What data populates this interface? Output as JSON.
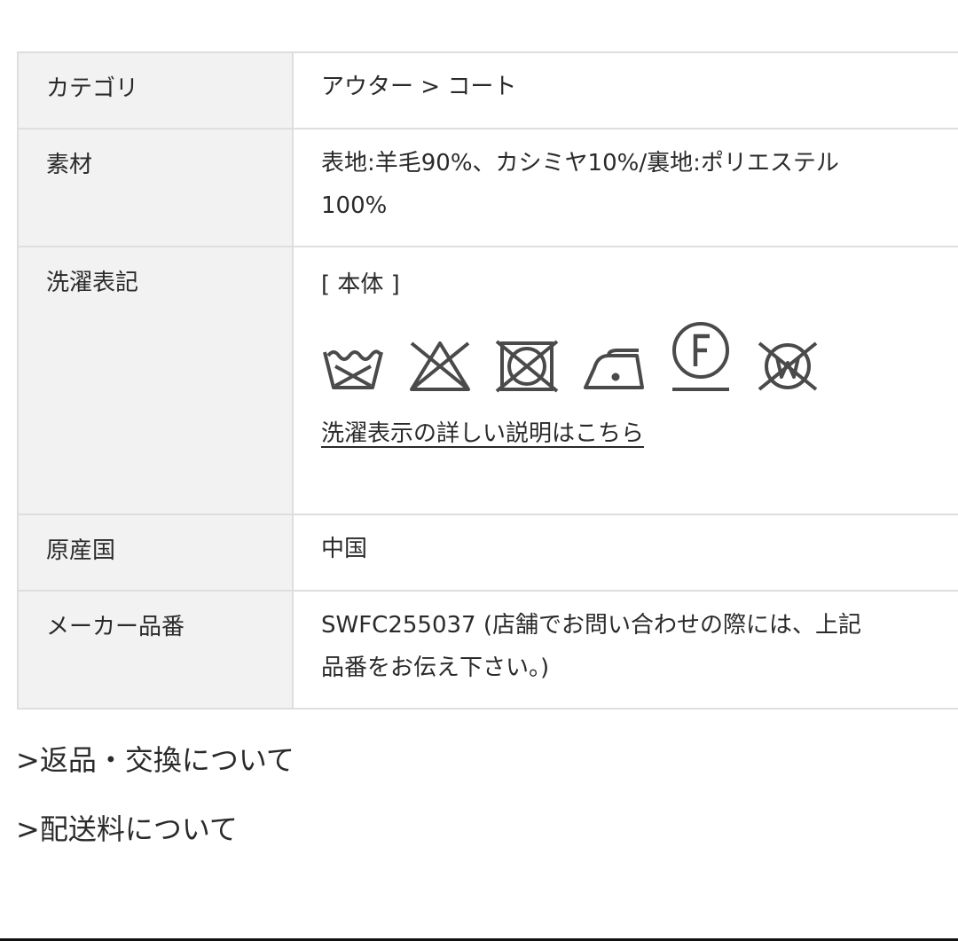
{
  "specs": {
    "category": {
      "label": "カテゴリ",
      "value": "アウター > コート"
    },
    "material": {
      "label": "素材",
      "value_line1": "表地:羊毛90%、カシミヤ10%/裏地:ポリエステル",
      "value_line2": "100%"
    },
    "care": {
      "label": "洗濯表記",
      "section": "[ 本体 ]",
      "icons": [
        "wash-tub-icon",
        "no-bleach-icon",
        "no-tumble-dry-icon",
        "low-iron-icon",
        "dry-clean-f-icon",
        "no-wet-clean-icon"
      ],
      "link": "洗濯表示の詳しい説明はこちら"
    },
    "origin": {
      "label": "原産国",
      "value": "中国"
    },
    "maker": {
      "label": "メーカー品番",
      "value_line1": "SWFC255037 (店舗でお問い合わせの際には、上記",
      "value_line2": "品番をお伝え下さい。)"
    }
  },
  "links": {
    "returns": ">返品・交換について",
    "shipping": ">配送料について"
  },
  "colors": {
    "label_bg": "#f2f2f2",
    "border": "#dedede",
    "icon": "#4a4a4a",
    "text": "#2a2a2a"
  }
}
